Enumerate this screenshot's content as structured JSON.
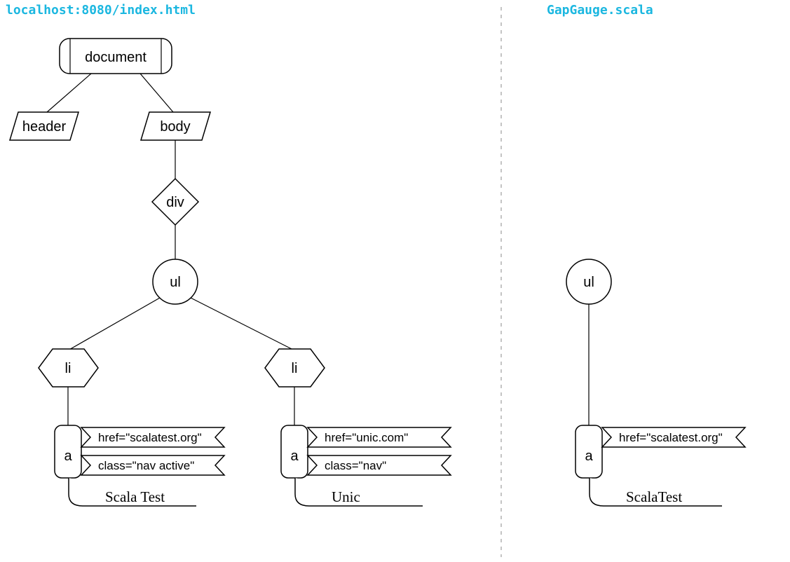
{
  "left": {
    "title": "localhost:8080/index.html",
    "nodes": {
      "document": "document",
      "header": "header",
      "body": "body",
      "div": "div",
      "ul": "ul",
      "li1": "li",
      "li2": "li",
      "a1": "a",
      "a2": "a"
    },
    "a1": {
      "href": "href=\"scalatest.org\"",
      "class": "class=\"nav active\"",
      "text": "Scala Test"
    },
    "a2": {
      "href": "href=\"unic.com\"",
      "class": "class=\"nav\"",
      "text": "Unic"
    }
  },
  "right": {
    "title": "GapGauge.scala",
    "nodes": {
      "ul": "ul",
      "a": "a"
    },
    "a": {
      "href": "href=\"scalatest.org\"",
      "text": "ScalaTest"
    }
  }
}
